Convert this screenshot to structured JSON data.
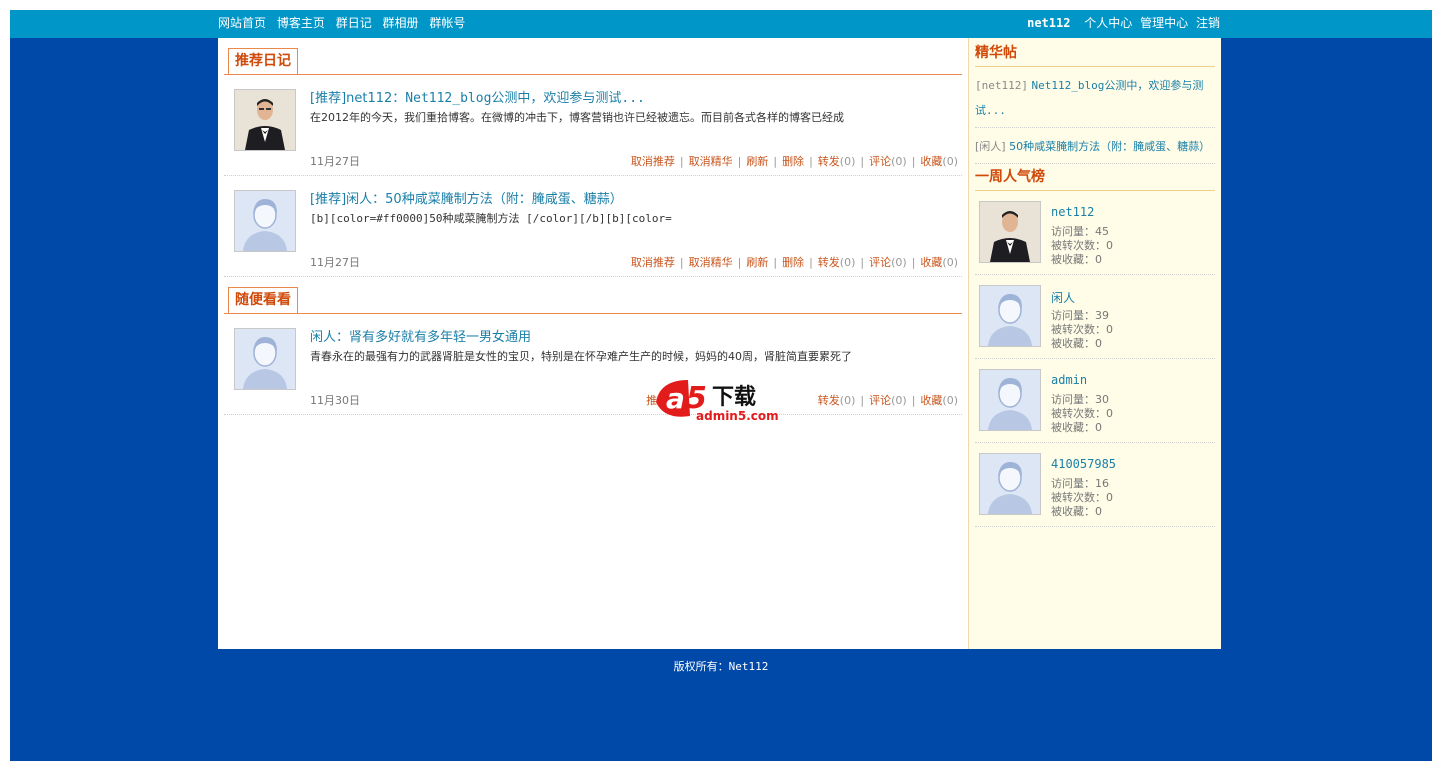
{
  "nav": {
    "links": [
      "网站首页",
      "博客主页",
      "群日记",
      "群相册",
      "群帐号"
    ],
    "user": "net112",
    "right_links": [
      "个人中心",
      "管理中心",
      "注销"
    ]
  },
  "recommended": {
    "title": "推荐日记",
    "posts": [
      {
        "title_prefix": "[推荐]net112：",
        "title_text": "Net112_blog公测中，欢迎参与测试...",
        "body": "在2012年的今天，我们重拾博客。在微博的冲击下，博客营销也许已经被遗忘。而目前各式各样的博客已经成",
        "date": "11月27日",
        "actions": [
          "取消推荐",
          "取消精华",
          "刷新",
          "删除",
          "转发",
          "评论",
          "收藏"
        ],
        "counts": [
          "(0)",
          "(0)",
          "(0)"
        ]
      },
      {
        "title_prefix": "[推荐]闲人：",
        "title_text": "50种咸菜腌制方法（附：腌咸蛋、糖蒜）",
        "body": "[b][color=#ff0000]50种咸菜腌制方法  [/color][/b][b][color=",
        "date": "11月27日",
        "actions": [
          "取消推荐",
          "取消精华",
          "刷新",
          "删除",
          "转发",
          "评论",
          "收藏"
        ],
        "counts": [
          "(0)",
          "(0)",
          "(0)"
        ]
      }
    ]
  },
  "casual": {
    "title": "随便看看",
    "posts": [
      {
        "title_prefix": "闲人：",
        "title_text": "肾有多好就有多年轻一男女通用",
        "body": "青春永在的最强有力的武器肾脏是女性的宝贝，特别是在怀孕难产生产的时候，妈妈的40周，肾脏简直要累死了",
        "date": "11月30日",
        "actions": [
          "推荐",
          "转发",
          "评论",
          "收藏"
        ],
        "counts": [
          "(0)",
          "(0)",
          "(0)"
        ]
      }
    ]
  },
  "featured": {
    "title": "精华帖",
    "items": [
      {
        "tag": "[net112]",
        "text": "Net112_blog公测中，欢迎参与测试..."
      },
      {
        "tag": "[闲人]",
        "text": "50种咸菜腌制方法（附：腌咸蛋、糖蒜）"
      }
    ]
  },
  "weekly": {
    "title": "一周人气榜",
    "labels": {
      "visits": "访问量：",
      "forwards": "被转次数：",
      "favorites": "被收藏："
    },
    "users": [
      {
        "name": "net112",
        "visits": "45",
        "forwards": "0",
        "favorites": "0",
        "avatar": "photo"
      },
      {
        "name": "闲人",
        "visits": "39",
        "forwards": "0",
        "favorites": "0",
        "avatar": "default"
      },
      {
        "name": "admin",
        "visits": "30",
        "forwards": "0",
        "favorites": "0",
        "avatar": "default"
      },
      {
        "name": "410057985",
        "visits": "16",
        "forwards": "0",
        "favorites": "0",
        "avatar": "default"
      }
    ]
  },
  "footer": {
    "label": "版权所有：",
    "owner": "Net112"
  },
  "watermark": {
    "logo": "a5下载",
    "site": "admin5.com"
  },
  "colors": {
    "frame": "#0049a9",
    "topbar": "#0096c8",
    "accent": "#d04a0a",
    "link": "#1a7fa8",
    "sidebar": "#fffde8"
  }
}
